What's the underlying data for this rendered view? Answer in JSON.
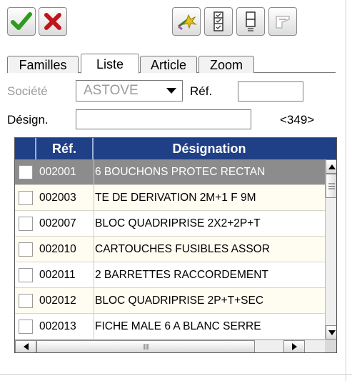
{
  "toolbar": {
    "ok_icon": "checkmark-icon",
    "cancel_icon": "cross-icon",
    "tool_icons": [
      "wand-icon",
      "list-check-icon",
      "list-icon",
      "tag-icon"
    ],
    "colors": {
      "ok": "#2f9a1f",
      "cancel": "#c0161a"
    }
  },
  "tabs": [
    {
      "label": "Familles",
      "active": false
    },
    {
      "label": "Liste",
      "active": true
    },
    {
      "label": "Article",
      "active": false
    },
    {
      "label": "Zoom",
      "active": false
    }
  ],
  "form": {
    "societe_label": "Société",
    "societe_value": "ASTOVE",
    "ref_label": "Réf.",
    "ref_value": "",
    "designation_label": "Désign.",
    "designation_value": "",
    "count": "<349>"
  },
  "table": {
    "headers": {
      "ref": "Réf.",
      "designation": "Désignation"
    },
    "header_color": "#1f3f86",
    "rows": [
      {
        "ref": "002001",
        "designation": "6 BOUCHONS PROTEC RECTAN",
        "selected": true
      },
      {
        "ref": "002003",
        "designation": "TE DE DERIVATION 2M+1 F 9M",
        "selected": false
      },
      {
        "ref": "002007",
        "designation": "BLOC QUADRIPRISE 2X2+2P+T",
        "selected": false
      },
      {
        "ref": "002010",
        "designation": "CARTOUCHES FUSIBLES ASSOR",
        "selected": false
      },
      {
        "ref": "002011",
        "designation": "2 BARRETTES RACCORDEMENT",
        "selected": false
      },
      {
        "ref": "002012",
        "designation": "BLOC QUADRIPRISE 2P+T+SEC",
        "selected": false
      },
      {
        "ref": "002013",
        "designation": "FICHE MALE 6 A BLANC SERRE",
        "selected": false
      }
    ]
  }
}
